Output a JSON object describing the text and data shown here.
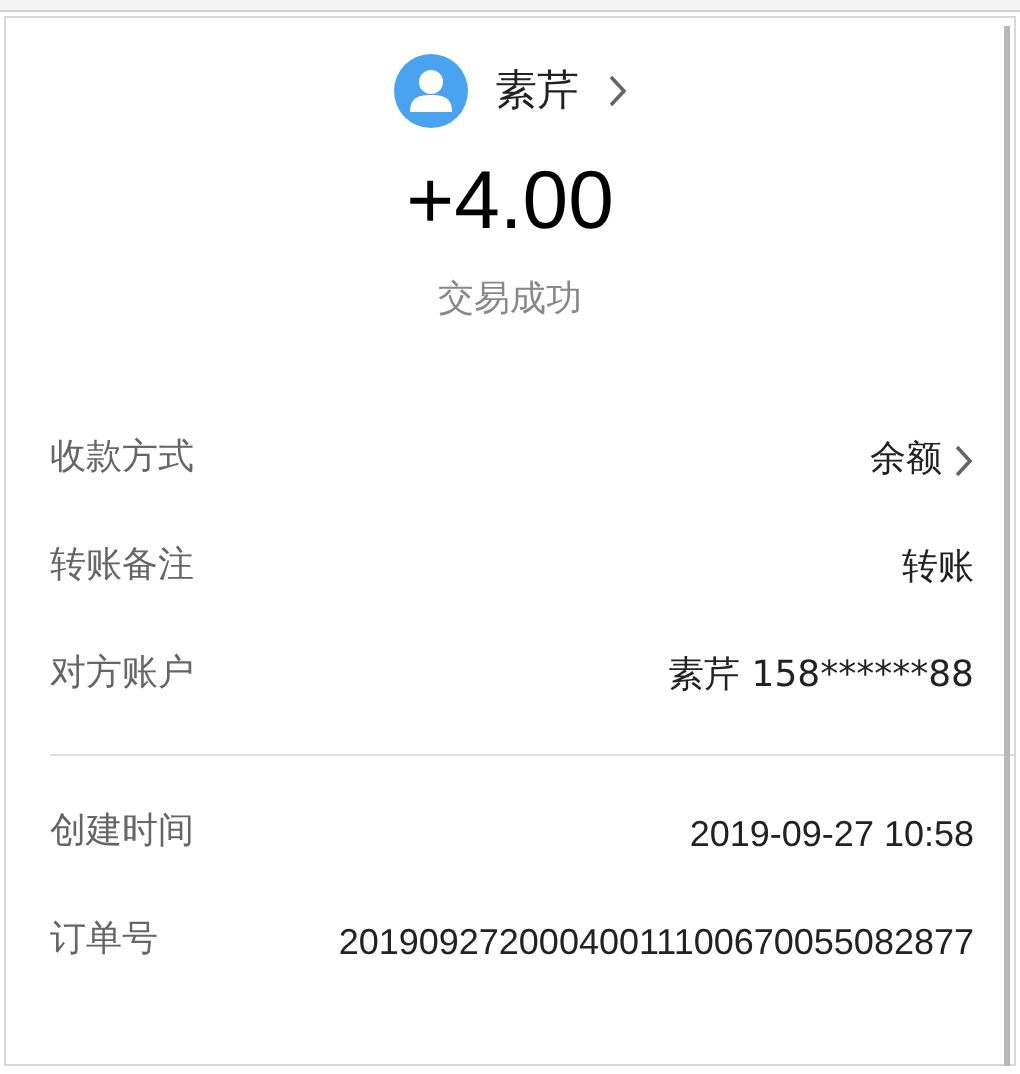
{
  "header": {
    "name": "素芹",
    "amount": "+4.00",
    "status": "交易成功"
  },
  "sections": [
    {
      "rows": [
        {
          "label": "收款方式",
          "value": "余额",
          "arrow": true
        },
        {
          "label": "转账备注",
          "value": "转账",
          "arrow": false
        },
        {
          "label": "对方账户",
          "value": "素芹 158******88",
          "arrow": false
        }
      ]
    },
    {
      "rows": [
        {
          "label": "创建时间",
          "value": "2019-09-27 10:58",
          "arrow": false
        },
        {
          "label": "订单号",
          "value": "20190927200040011100670055082877",
          "arrow": false
        }
      ]
    }
  ]
}
